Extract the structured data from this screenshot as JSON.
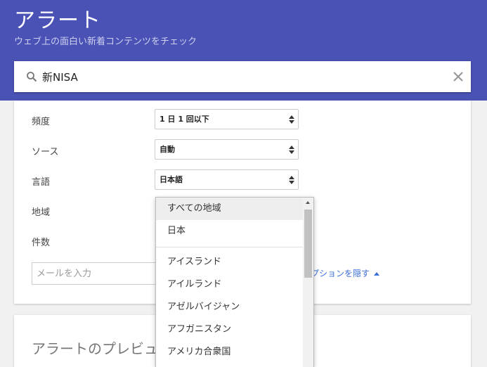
{
  "header": {
    "title": "アラート",
    "subtitle": "ウェブ上の面白い新着コンテンツをチェック"
  },
  "search": {
    "value": "新NISA",
    "icon": "search-icon",
    "clear_icon": "close-icon"
  },
  "options": {
    "frequency": {
      "label": "頻度",
      "value": "1 日 1 回以下"
    },
    "source": {
      "label": "ソース",
      "value": "自動"
    },
    "language": {
      "label": "言語",
      "value": "日本語"
    },
    "region": {
      "label": "地域"
    },
    "count": {
      "label": "件数"
    }
  },
  "email": {
    "placeholder": "メールを入力"
  },
  "hide_options_label": "オプションを隠す",
  "region_dropdown": {
    "selected": "すべての地域",
    "top": [
      "すべての地域",
      "日本"
    ],
    "items": [
      "アイスランド",
      "アイルランド",
      "アゼルバイジャン",
      "アフガニスタン",
      "アメリカ合衆国"
    ]
  },
  "preview": {
    "title": "アラートのプレビュー"
  },
  "colors": {
    "header_bg": "#4a52b5",
    "link": "#3b6fd6"
  }
}
